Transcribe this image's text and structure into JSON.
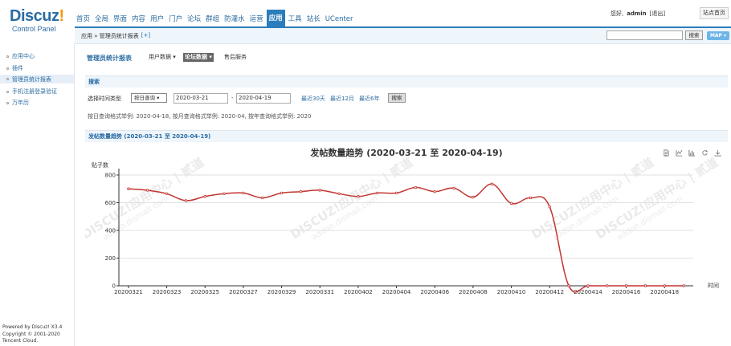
{
  "header": {
    "logo_text": "Discuz",
    "logo_bang": "!",
    "logo_sub": "Control Panel",
    "nav": [
      "首页",
      "全局",
      "界面",
      "内容",
      "用户",
      "门户",
      "论坛",
      "群组",
      "防灌水",
      "运营",
      "应用",
      "工具",
      "站长",
      "UCenter"
    ],
    "nav_active_index": 10,
    "greeting_prefix": "您好,",
    "username": "admin",
    "logout": "[退出]",
    "home_button": "站点首页",
    "search_button": "搜索",
    "map_button": "MAP ▾"
  },
  "breadcrumb": {
    "path": "应用 » 管理员统计报表",
    "plus": "[+]"
  },
  "sidebar": {
    "items": [
      "应用中心",
      "插件",
      "管理员统计报表",
      "手机注册登录验证",
      "万年历"
    ],
    "active_index": 2,
    "powered": [
      "Powered by Discuz! X3.4",
      "Copyright © 2001-2020",
      "Tencent Cloud."
    ]
  },
  "main": {
    "title": "管理员统计报表",
    "tabs": [
      "用户数据 ▾",
      "论坛数据 ▾",
      "售后服务"
    ],
    "active_tab": 1,
    "search_section": "搜索",
    "type_label": "选择时间类型",
    "type_value": "按日查询 ▾",
    "date_from": "2020-03-21",
    "date_sep": "-",
    "date_to": "2020-04-19",
    "quick_links": [
      "最近30天",
      "最近12月",
      "最近6年"
    ],
    "query_button": "搜索",
    "hint": "按日查询格式举例: 2020-04-18, 按月查询格式举例: 2020-04, 按年查询格式举例: 2020",
    "chart_section": "发帖数量趋势 (2020-03-21 至 2020-04-19)",
    "watermarks": [
      "DISCUZ!应用中心 | 贰道",
      "addon.dismall.com"
    ]
  },
  "chart_data": {
    "type": "line",
    "title": "发帖数量趋势 (2020-03-21 至 2020-04-19)",
    "ylabel": "贴子数",
    "xlabel": "时间",
    "ylim": [
      0,
      800
    ],
    "yticks": [
      0,
      200,
      400,
      600,
      800
    ],
    "x_tick_labels": [
      "20200321",
      "20200323",
      "20200325",
      "20200327",
      "20200329",
      "20200331",
      "20200402",
      "20200404",
      "20200406",
      "20200408",
      "20200410",
      "20200412",
      "20200414",
      "20200416",
      "20200418"
    ],
    "x": [
      "20200321",
      "20200322",
      "20200323",
      "20200324",
      "20200325",
      "20200326",
      "20200327",
      "20200328",
      "20200329",
      "20200330",
      "20200331",
      "20200401",
      "20200402",
      "20200403",
      "20200404",
      "20200405",
      "20200406",
      "20200407",
      "20200408",
      "20200409",
      "20200410",
      "20200411",
      "20200412",
      "20200413",
      "20200414",
      "20200415",
      "20200416",
      "20200417",
      "20200418",
      "20200419"
    ],
    "series": [
      {
        "color": "#c23531",
        "values": [
          700,
          690,
          665,
          615,
          645,
          665,
          670,
          635,
          670,
          680,
          690,
          665,
          645,
          670,
          670,
          710,
          680,
          705,
          640,
          735,
          595,
          635,
          570,
          0,
          0,
          0,
          0,
          0,
          0,
          0
        ]
      }
    ],
    "grid": true,
    "legend": "none",
    "toolbox_icons": [
      "data-view-icon",
      "line-icon",
      "bar-icon",
      "restore-icon",
      "download-icon"
    ]
  }
}
